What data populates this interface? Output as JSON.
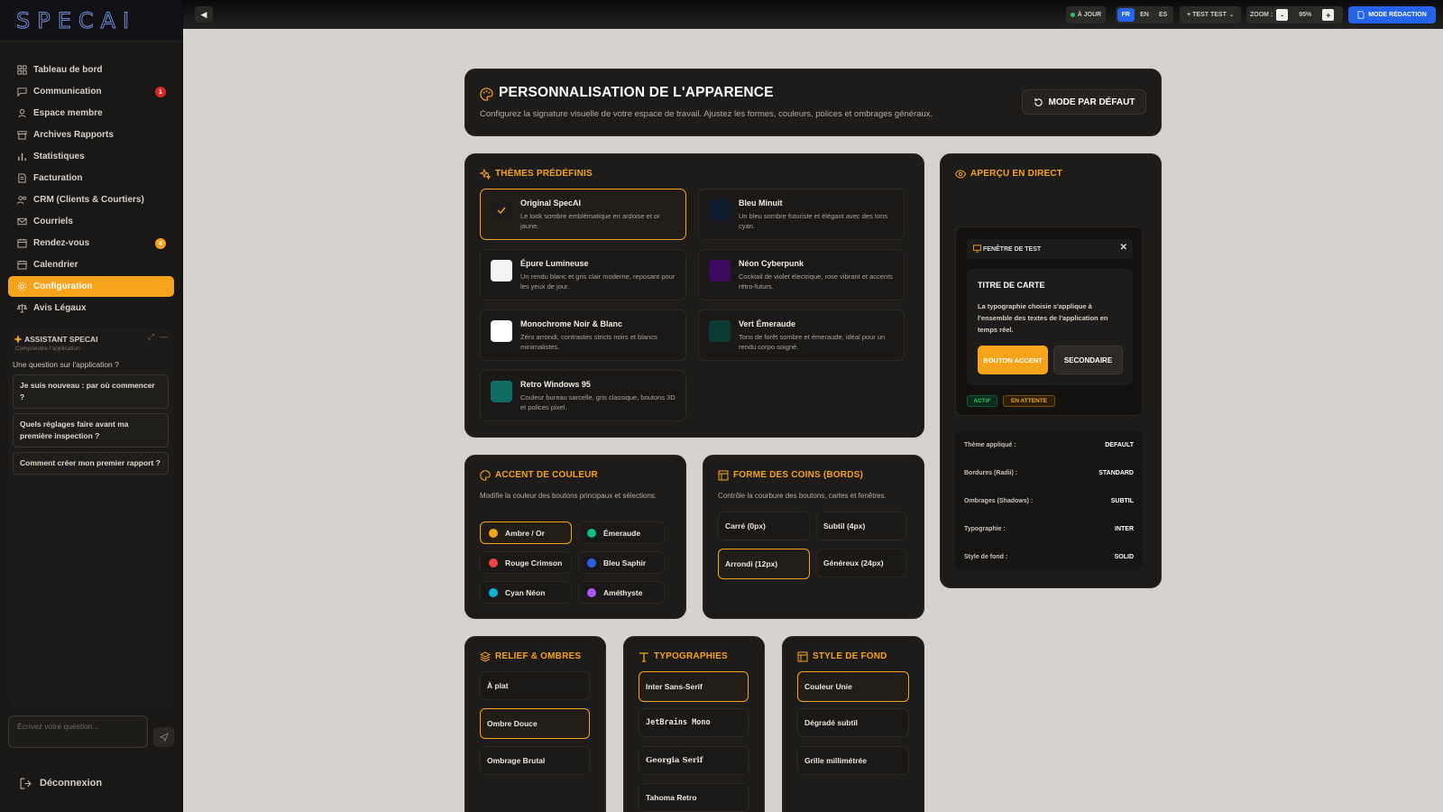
{
  "sidebar": {
    "logo": "SPECAI",
    "items": [
      {
        "label": "Tableau de bord",
        "icon": "dashboard-icon"
      },
      {
        "label": "Communication",
        "icon": "chat-icon",
        "badge": "1",
        "badge_color": "#dc2626"
      },
      {
        "label": "Espace membre",
        "icon": "user-icon"
      },
      {
        "label": "Archives Rapports",
        "icon": "archive-icon"
      },
      {
        "label": "Statistiques",
        "icon": "bar-chart-icon"
      },
      {
        "label": "Facturation",
        "icon": "invoice-icon"
      },
      {
        "label": "CRM (Clients & Courtiers)",
        "icon": "users-icon"
      },
      {
        "label": "Courriels",
        "icon": "mail-icon"
      },
      {
        "label": "Rendez-vous",
        "icon": "calendar-icon",
        "badge": "4",
        "badge_color": "#f5a31a"
      },
      {
        "label": "Calendrier",
        "icon": "calendar-icon"
      },
      {
        "label": "Configuration",
        "icon": "gear-icon",
        "active": true
      },
      {
        "label": "Avis Légaux",
        "icon": "scale-icon"
      }
    ],
    "assistant": {
      "title": "ASSISTANT SPECAI",
      "subtitle": "Comprendre l'application",
      "question": "Une question sur l'application ?",
      "suggestions": [
        "Je suis nouveau : par où commencer ?",
        "Quels réglages faire avant ma première inspection ?",
        "Comment créer mon premier rapport ?"
      ],
      "input_placeholder": "Écrivez votre question..."
    },
    "logout": "Déconnexion"
  },
  "topbar": {
    "status": "À JOUR",
    "langs": [
      "FR",
      "EN",
      "ES"
    ],
    "active_lang": "FR",
    "user": "+ TEST TEST",
    "zoom_label": "ZOOM :",
    "zoom_value": "95%",
    "zoom_minus": "-",
    "zoom_plus": "+",
    "mode_button": "MODE RÉDACTION"
  },
  "header": {
    "title": "PERSONNALISATION DE L'APPARENCE",
    "description": "Configurez la signature visuelle de votre espace de travail. Ajustez les formes, couleurs, polices et ombrages généraux.",
    "reset_button": "MODE PAR DÉFAUT"
  },
  "themes": {
    "title": "THÈMES PRÉDÉFINIS",
    "items": [
      {
        "name": "Original SpecAI",
        "desc": "Le look sombre emblématique en ardoise et or jaune.",
        "swatch": "#1e1c1a",
        "selected": true
      },
      {
        "name": "Bleu Minuit",
        "desc": "Un bleu sombre futuriste et élégant avec des tons cyan.",
        "swatch": "#0f1a2e"
      },
      {
        "name": "Épure Lumineuse",
        "desc": "Un rendu blanc et gris clair moderne, reposant pour les yeux de jour.",
        "swatch": "#f4f4f4"
      },
      {
        "name": "Néon Cyberpunk",
        "desc": "Cocktail de violet électrique, rose vibrant et accents rétro-futurs.",
        "swatch": "#3b0a5e"
      },
      {
        "name": "Monochrome Noir & Blanc",
        "desc": "Zéro arrondi, contrastes stricts noirs et blancs minimalistes.",
        "swatch": "#ffffff"
      },
      {
        "name": "Vert Émeraude",
        "desc": "Tons de forêt sombre et émeraude, idéal pour un rendu corpo soigné.",
        "swatch": "#0d3b33"
      },
      {
        "name": "Retro Windows 95",
        "desc": "Couleur bureau sarcelle, gris classique, boutons 3D et polices pixel.",
        "swatch": "#0f6b63"
      }
    ]
  },
  "accent": {
    "title": "ACCENT DE COULEUR",
    "description": "Modifie la couleur des boutons principaux et sélections.",
    "options": [
      {
        "label": "Ambre / Or",
        "color": "#f5a31a",
        "selected": true
      },
      {
        "label": "Émeraude",
        "color": "#10b981"
      },
      {
        "label": "Rouge Crimson",
        "color": "#ef4444"
      },
      {
        "label": "Bleu Saphir",
        "color": "#2563eb"
      },
      {
        "label": "Cyan Néon",
        "color": "#06b6d4"
      },
      {
        "label": "Améthyste",
        "color": "#a855f7"
      }
    ]
  },
  "corners": {
    "title": "FORME DES COINS (BORDS)",
    "description": "Contrôle la courbure des boutons, cartes et fenêtres.",
    "options": [
      {
        "label": "Carré (0px)"
      },
      {
        "label": "Subtil (4px)"
      },
      {
        "label": "Arrondi (12px)",
        "selected": true
      },
      {
        "label": "Généreux (24px)"
      }
    ]
  },
  "relief": {
    "title": "RELIEF & OMBRES",
    "options": [
      {
        "label": "À plat"
      },
      {
        "label": "Ombre Douce",
        "selected": true
      },
      {
        "label": "Ombrage Brutal"
      }
    ]
  },
  "typo": {
    "title": "TYPOGRAPHIES",
    "options": [
      {
        "label": "Inter Sans-Serif",
        "selected": true
      },
      {
        "label": "JetBrains Mono"
      },
      {
        "label": "Georgia Serif"
      },
      {
        "label": "Tahoma Retro"
      }
    ]
  },
  "bg": {
    "title": "STYLE DE FOND",
    "options": [
      {
        "label": "Couleur Unie",
        "selected": true
      },
      {
        "label": "Dégradé subtil"
      },
      {
        "label": "Grille millimétrée"
      }
    ]
  },
  "preview": {
    "title": "APERÇU EN DIRECT",
    "window_title": "FENÊTRE DE TEST",
    "card_title": "TITRE DE CARTE",
    "card_text": "La typographie choisie s'applique à l'ensemble des textes de l'application en temps réel.",
    "accent_button": "BOUTON ACCENT",
    "secondary_button": "SECONDAIRE",
    "tag_active": "ACTIF",
    "tag_pending": "EN ATTENTE",
    "info": [
      {
        "label": "Thème appliqué :",
        "value": "DEFAULT"
      },
      {
        "label": "Bordures (Radii) :",
        "value": "STANDARD"
      },
      {
        "label": "Ombrages (Shadows) :",
        "value": "SUBTIL"
      },
      {
        "label": "Typographie :",
        "value": "INTER"
      },
      {
        "label": "Style de fond :",
        "value": "SOLID"
      }
    ]
  }
}
